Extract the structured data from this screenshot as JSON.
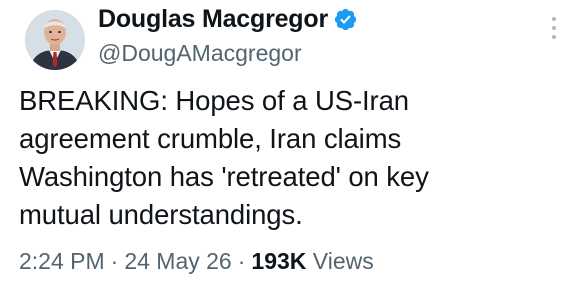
{
  "author": {
    "display_name": "Douglas Macgregor",
    "handle": "@DougAMacgregor",
    "verified": true,
    "avatar_icon": "profile-photo"
  },
  "tweet": {
    "text": "BREAKING:  Hopes of a US-Iran\nagreement crumble, Iran claims\nWashington has 'retreated' on key\nmutual understandings."
  },
  "meta": {
    "time": "2:24 PM",
    "separator": "·",
    "date": "24 May 26",
    "views_count": "193K",
    "views_label": "Views"
  },
  "icons": {
    "verified": "verified-badge-icon",
    "more": "more-options-icon"
  },
  "colors": {
    "verified_blue": "#1d9bf0",
    "secondary_text": "#536471",
    "primary_text": "#0f1419"
  }
}
